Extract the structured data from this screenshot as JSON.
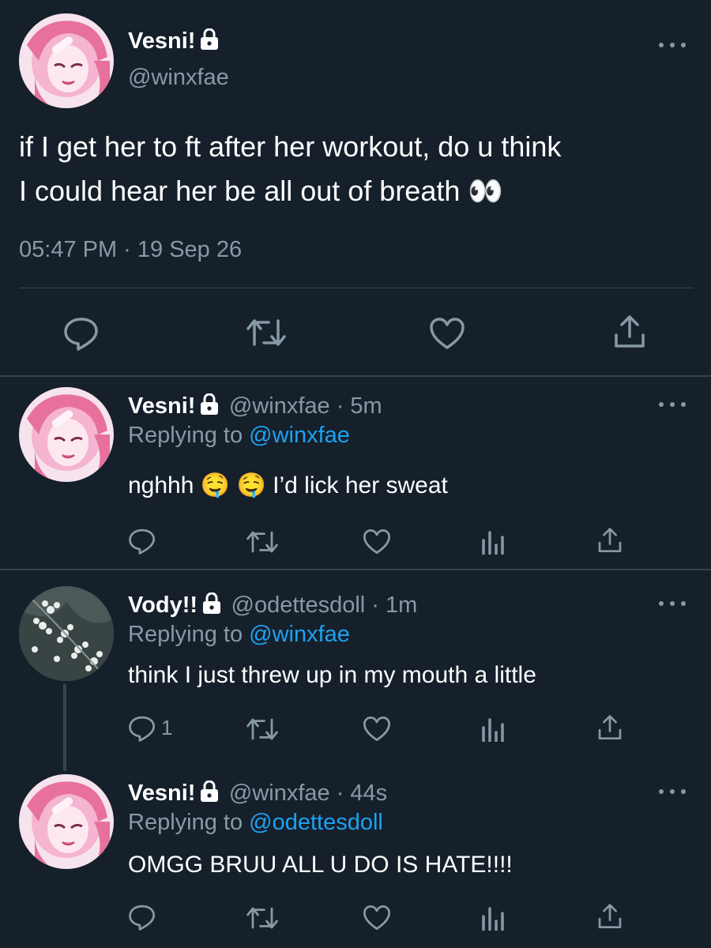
{
  "main_tweet": {
    "display_name": "Vesni!",
    "handle": "@winxfae",
    "text_line1": "if I get her to ft after her workout, do u think",
    "text_line2": "I could hear her be all out of breath 👀",
    "timestamp": "05:47 PM · 19 Sep 26"
  },
  "replies": [
    {
      "display_name": "Vesni!",
      "handle_time": "@winxfae · 5m",
      "replying_prefix": "Replying to ",
      "replying_to": "@winxfae",
      "text": "nghhh 🤤 🤤  I’d lick her sweat",
      "reply_count": ""
    },
    {
      "display_name": "Vody!!",
      "handle_time": "@odettesdoll · 1m",
      "replying_prefix": "Replying to ",
      "replying_to": "@winxfae",
      "text": "think I just threw up in my mouth a little",
      "reply_count": "1"
    },
    {
      "display_name": "Vesni!",
      "handle_time": "@winxfae · 44s",
      "replying_prefix": "Replying to ",
      "replying_to": "@odettesdoll",
      "text": "OMGG BRUU ALL U DO IS HATE!!!!",
      "reply_count": ""
    }
  ],
  "colors": {
    "background": "#15202b",
    "secondary_text": "#8899a6",
    "accent": "#1da1f2",
    "divider": "#38444d"
  },
  "icons": [
    "lock-icon",
    "more-icon",
    "reply-icon",
    "retweet-icon",
    "like-icon",
    "share-icon",
    "analytics-icon"
  ]
}
